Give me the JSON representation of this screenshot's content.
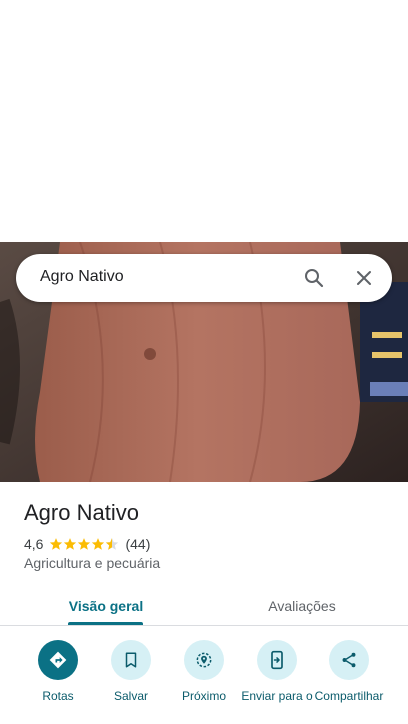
{
  "search": {
    "query": "Agro Nativo"
  },
  "place": {
    "name": "Agro Nativo",
    "rating": "4,6",
    "review_count": "(44)",
    "category": "Agricultura e pecuária"
  },
  "tabs": [
    {
      "label": "Visão geral"
    },
    {
      "label": "Avaliações"
    }
  ],
  "actions": [
    {
      "label": "Rotas",
      "icon": "directions-icon"
    },
    {
      "label": "Salvar",
      "icon": "bookmark-icon"
    },
    {
      "label": "Próximo",
      "icon": "nearby-icon"
    },
    {
      "label": "Enviar para o",
      "icon": "send-to-phone-icon"
    },
    {
      "label": "Compartilhar",
      "icon": "share-icon"
    }
  ],
  "colors": {
    "accent": "#0b7185",
    "chip": "#d6f0f5",
    "star": "#fbbc04"
  }
}
